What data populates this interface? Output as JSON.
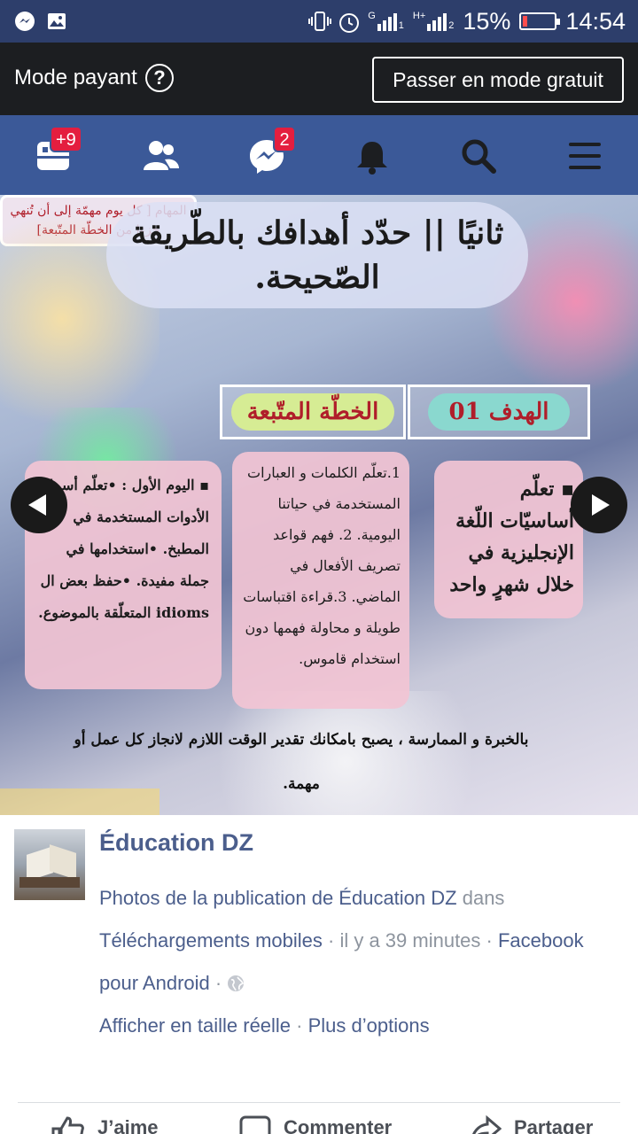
{
  "status_bar": {
    "battery_percent": "15%",
    "battery_level": 0.15,
    "time": "14:54",
    "left_icons": [
      "messenger-icon",
      "image-icon"
    ],
    "right_icons": [
      "vibrate-icon",
      "alarm-icon",
      "signal-icon",
      "signal-icon"
    ],
    "sim1_tag": "G",
    "sim1_num": "1",
    "sim2_tag": "H+",
    "sim2_num": "2"
  },
  "mode_bar": {
    "label": "Mode payant",
    "help": "?",
    "switch_button": "Passer en mode gratuit"
  },
  "nav": {
    "items": [
      {
        "icon": "news-feed-icon",
        "badge": "+9"
      },
      {
        "icon": "friends-icon",
        "badge": ""
      },
      {
        "icon": "messenger-icon",
        "badge": "2"
      },
      {
        "icon": "notifications-bell-icon",
        "badge": ""
      },
      {
        "icon": "search-icon",
        "badge": ""
      },
      {
        "icon": "menu-icon",
        "badge": ""
      }
    ]
  },
  "photo": {
    "title": "ثانيًا || حدّد أهدافك بالطّريقة الصّحيحة.",
    "goal_header": "الهدف 01",
    "plan_header": "الخطّة المتّبعة",
    "tasks_header": "المهام [ كل يوم مهمّة إلى أن تُنهي جزءا من الخطّة المتّبعة]",
    "goal_text": "▪ تعلّم أساسيّات اللّغة الإنجليزية في خلال شهرٍ واحد",
    "plan_text": "1.تعلّم الكلمات و العبارات المستخدمة في حياتنا اليومية. 2. فهم قواعد تصريف الأفعال في الماضي. 3.قراءة اقتباسات طويلة و محاولة فهمها دون استخدام قاموس.",
    "tasks_text": "▪ اليوم الأول : •تعلّم أسماء الأدوات المستخدمة في المطبخ. •استخدامها في جملة مفيدة. •حفظ بعض ال idioms المتعلّقة بالموضوع.",
    "footer_note": "بالخبرة و الممارسة ، يصبح بامكانك تقدير الوقت اللازم لانجاز كل عمل أو مهمة."
  },
  "post": {
    "page_name": "Éducation DZ",
    "line1_link": "Photos de la publication de Éducation DZ",
    "line1_rest": " dans",
    "line2_link": "Téléchargements mobiles",
    "line2_rest": " · il y a 39 minutes · ",
    "line2_link2": "Facebook",
    "line3_link": "pour Android",
    "line3_rest": " · ",
    "line4_link1": "Afficher en taille réelle",
    "line4_sep": " · ",
    "line4_link2": "Plus d’options"
  },
  "actions": {
    "like": "J’aime",
    "comment": "Commenter",
    "share": "Partager"
  },
  "colors": {
    "status_bar": "#2d3e6b",
    "mode_bar": "#1c1e21",
    "nav_bar": "#3b5998",
    "badge": "#e41e3f",
    "link": "#4b5e8c",
    "meta_text": "#8d949e"
  }
}
